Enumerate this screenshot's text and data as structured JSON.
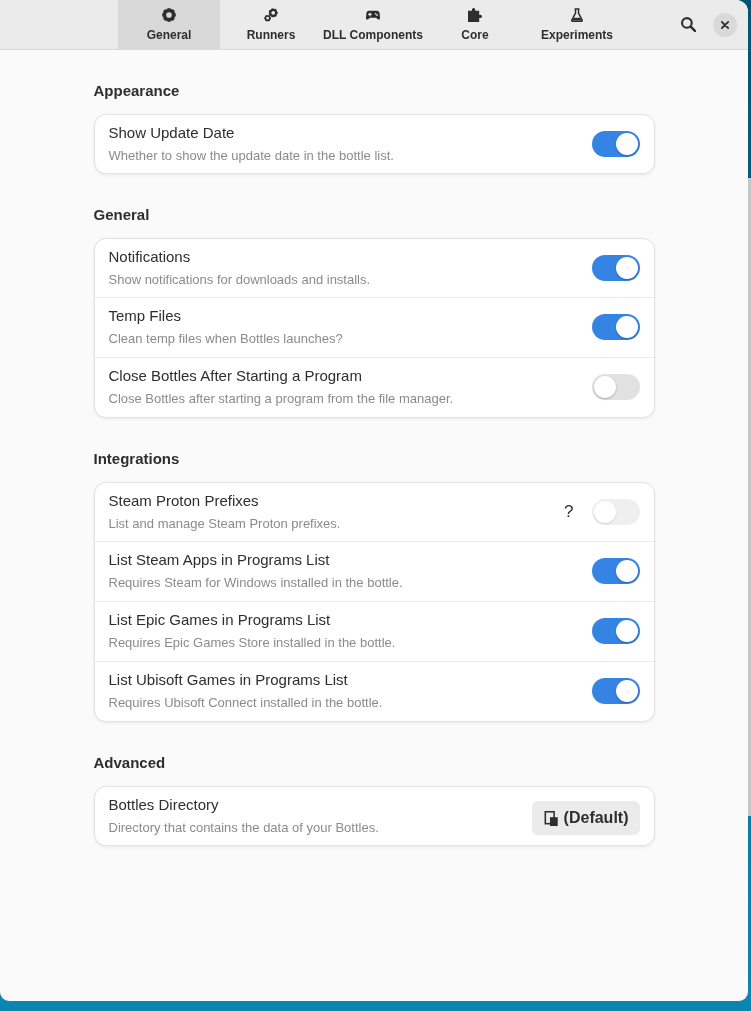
{
  "header": {
    "tabs": [
      {
        "label": "General",
        "selected": true
      },
      {
        "label": "Runners",
        "selected": false
      },
      {
        "label": "DLL Components",
        "selected": false
      },
      {
        "label": "Core",
        "selected": false
      },
      {
        "label": "Experiments",
        "selected": false
      }
    ]
  },
  "sections": [
    {
      "title": "Appearance",
      "rows": [
        {
          "kind": "switch",
          "title": "Show Update Date",
          "subtitle": "Whether to show the update date in the bottle list.",
          "on": true,
          "disabled": false
        }
      ]
    },
    {
      "title": "General",
      "rows": [
        {
          "kind": "switch",
          "title": "Notifications",
          "subtitle": "Show notifications for downloads and installs.",
          "on": true,
          "disabled": false
        },
        {
          "kind": "switch",
          "title": "Temp Files",
          "subtitle": "Clean temp files when Bottles launches?",
          "on": true,
          "disabled": false
        },
        {
          "kind": "switch",
          "title": "Close Bottles After Starting a Program",
          "subtitle": "Close Bottles after starting a program from the file manager.",
          "on": false,
          "disabled": false
        }
      ]
    },
    {
      "title": "Integrations",
      "rows": [
        {
          "kind": "switch",
          "title": "Steam Proton Prefixes",
          "subtitle": "List and manage Steam Proton prefixes.",
          "help": "?",
          "on": false,
          "disabled": true
        },
        {
          "kind": "switch",
          "title": "List Steam Apps in Programs List",
          "subtitle": "Requires Steam for Windows installed in the bottle.",
          "on": true,
          "disabled": false
        },
        {
          "kind": "switch",
          "title": "List Epic Games in Programs List",
          "subtitle": "Requires Epic Games Store installed in the bottle.",
          "on": true,
          "disabled": false
        },
        {
          "kind": "switch",
          "title": "List Ubisoft Games in Programs List",
          "subtitle": "Requires Ubisoft Connect installed in the bottle.",
          "on": true,
          "disabled": false
        }
      ]
    },
    {
      "title": "Advanced",
      "rows": [
        {
          "kind": "button",
          "title": "Bottles Directory",
          "subtitle": "Directory that contains the data of your Bottles.",
          "button": "(Default)",
          "disabled": false
        }
      ]
    }
  ]
}
